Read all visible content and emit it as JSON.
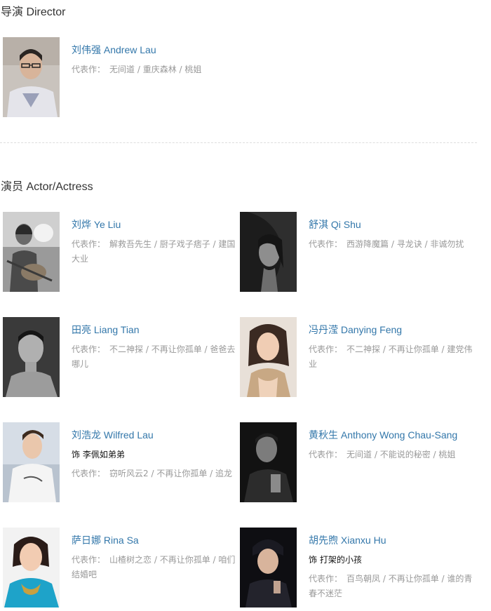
{
  "director_section": {
    "title": "导演 Director",
    "people": [
      {
        "name": "刘伟强 Andrew Lau",
        "works_label": "代表作：",
        "works": "无间道 / 重庆森林 / 桃姐",
        "photo": "portrait-photo"
      }
    ]
  },
  "actor_section": {
    "title": "演员 Actor/Actress",
    "people": [
      {
        "name": "刘烨 Ye Liu",
        "works_label": "代表作：",
        "works": "解救吾先生 / 厨子戏子痞子 / 建国大业",
        "photo": "portrait-photo"
      },
      {
        "name": "舒淇 Qi Shu",
        "works_label": "代表作：",
        "works": "西游降魔篇 / 寻龙诀 / 非诚勿扰",
        "photo": "portrait-photo"
      },
      {
        "name": "田亮 Liang Tian",
        "works_label": "代表作：",
        "works": "不二神探 / 不再让你孤单 / 爸爸去哪儿",
        "photo": "portrait-photo"
      },
      {
        "name": "冯丹滢 Danying Feng",
        "works_label": "代表作：",
        "works": "不二神探 / 不再让你孤单 / 建党伟业",
        "photo": "portrait-photo"
      },
      {
        "name": "刘浩龙 Wilfred Lau",
        "role": "饰 李佩如弟弟",
        "works_label": "代表作：",
        "works": "窃听风云2 / 不再让你孤单 / 追龙",
        "photo": "portrait-photo"
      },
      {
        "name": "黄秋生 Anthony Wong Chau-Sang",
        "works_label": "代表作：",
        "works": "无间道 / 不能说的秘密 / 桃姐",
        "photo": "portrait-photo"
      },
      {
        "name": "萨日娜 Rina Sa",
        "works_label": "代表作：",
        "works": "山楂树之恋 / 不再让你孤单 / 咱们结婚吧",
        "photo": "portrait-photo"
      },
      {
        "name": "胡先煦 Xianxu Hu",
        "role": "饰 打架的小孩",
        "works_label": "代表作：",
        "works": "百鸟朝凤 / 不再让你孤单 / 谁的青春不迷茫",
        "photo": "portrait-photo"
      }
    ]
  }
}
